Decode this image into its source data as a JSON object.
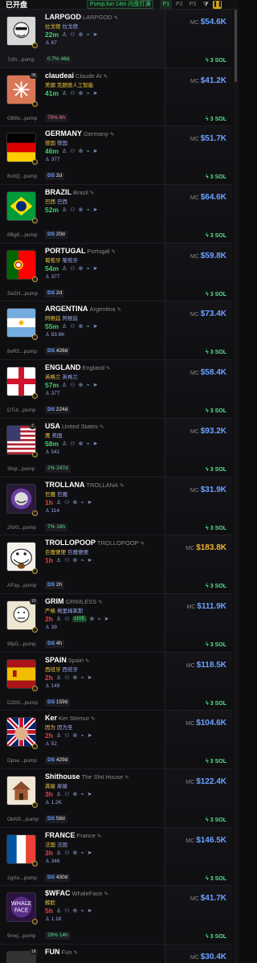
{
  "header": {
    "title": "已开盘",
    "filter": "Pump.fun 14m 内盘打满",
    "tabs": [
      "P1",
      "P2",
      "P3"
    ],
    "pause_icon": "pause-icon",
    "filter_icon": "funnel-icon"
  },
  "colors": {
    "green": "#3ad36b",
    "blue": "#6ea1ff",
    "yellow": "#f3b32c",
    "red": "#e44040"
  },
  "rows": [
    {
      "ticker": "LARPGOD",
      "fullname": "LARPGOD",
      "cn": "拉戈德",
      "cn2": "拉戈德",
      "age": "22m",
      "holders": "67",
      "addr": "7cfn...pump",
      "bottom1": "0.7% 46d",
      "mc_label": "MC",
      "mc": "$54.6K",
      "sol": "3 SOL",
      "avatar": "cartoon"
    },
    {
      "ticker": "claudeai",
      "fullname": "Claude AI",
      "cn": "美國 克朗德人工智能",
      "cn2": "",
      "age": "41m",
      "holders": "",
      "addr": "GB8v...pump",
      "bottom1": "79% 6h",
      "mc_label": "MC",
      "mc": "$41.2K",
      "sol": "3 SOL",
      "avatar": "claude",
      "badge": "38"
    },
    {
      "ticker": "GERMANY",
      "fullname": "Germany",
      "cn": "德国",
      "cn2": "德国",
      "age": "46m",
      "holders": "377",
      "addr": "8v3Q...pump",
      "bottom1": "DS 2d",
      "mc_label": "MC",
      "mc": "$51.7K",
      "sol": "3 SOL",
      "avatar": "germany"
    },
    {
      "ticker": "BRAZIL",
      "fullname": "Brazil",
      "cn": "巴西",
      "cn2": "巴西",
      "age": "52m",
      "holders": "",
      "addr": "8BgK...pump",
      "bottom1": "DS 20d",
      "mc_label": "MC",
      "mc": "$64.6K",
      "sol": "3 SOL",
      "avatar": "brazil"
    },
    {
      "ticker": "PORTUGAL",
      "fullname": "Portugal",
      "cn": "葡萄牙",
      "cn2": "葡萄牙",
      "age": "54m",
      "holders": "377",
      "addr": "Se2H...pump",
      "bottom1": "DS 2d",
      "mc_label": "MC",
      "mc": "$59.8K",
      "sol": "3 SOL",
      "avatar": "portugal"
    },
    {
      "ticker": "ARGENTINA",
      "fullname": "Argentina",
      "cn": "阿根廷",
      "cn2": "阿根廷",
      "age": "55m",
      "holders": "83.8K",
      "addr": "8vR5...pump",
      "bottom1": "DS 428d",
      "mc_label": "MC",
      "mc": "$73.4K",
      "sol": "3 SOL",
      "avatar": "argentina"
    },
    {
      "ticker": "ENGLAND",
      "fullname": "England",
      "cn": "英格兰",
      "cn2": "英格兰",
      "age": "57m",
      "holders": "377",
      "addr": "DTut...pump",
      "bottom1": "DS 224d",
      "mc_label": "MC",
      "mc": "$58.4K",
      "sol": "3 SOL",
      "avatar": "england"
    },
    {
      "ticker": "USA",
      "fullname": "United States",
      "cn": "鹰",
      "cn2": "美国",
      "age": "58m",
      "holders": "541",
      "addr": "3hqr...pump",
      "bottom1": "2% 247d",
      "mc_label": "MC",
      "mc": "$93.2K",
      "sol": "3 SOL",
      "avatar": "usa",
      "badge": "3"
    },
    {
      "ticker": "TROLLANA",
      "fullname": "TROLLANA",
      "cn": "巨魔",
      "cn2": "巨魔",
      "age": "1h",
      "holders": "114",
      "addr": "2NXt...pump",
      "bottom1": "7% 16h",
      "mc_label": "MC",
      "mc": "$31.9K",
      "sol": "3 SOL",
      "avatar": "trollana",
      "agered": true
    },
    {
      "ticker": "TROLLOPOOP",
      "fullname": "TROLLOPOOP",
      "cn": "巨魔便便",
      "cn2": "巨魔便便",
      "age": "1h",
      "holders": "",
      "addr": "AFay...pump",
      "bottom1": "DS 2h",
      "mc_label": "MC",
      "mc": "$183.8K",
      "sol": "3 SOL",
      "avatar": "trollface",
      "agered": true,
      "mcyellow": true
    },
    {
      "ticker": "GRIM",
      "fullname": "GRIMLESS",
      "cn": "严格",
      "cn2": "格里姆莱斯",
      "age": "2h",
      "holders": "39",
      "addr": "9fpG...pump",
      "bottom1": "DS 4h",
      "mc_label": "MC",
      "mc": "$111.9K",
      "sol": "3 SOL",
      "avatar": "grim",
      "agered": true,
      "live": "LIVE",
      "badge": "10"
    },
    {
      "ticker": "SPAIN",
      "fullname": "Spain",
      "cn": "西班牙",
      "cn2": "西班牙",
      "age": "2h",
      "holders": "149",
      "addr": "D2bS...pump",
      "bottom1": "DS 159d",
      "mc_label": "MC",
      "mc": "$118.5K",
      "sol": "3 SOL",
      "avatar": "spain",
      "agered": true
    },
    {
      "ticker": "Ker",
      "fullname": "Ker Stemur",
      "cn": "因为",
      "cn2": "因为圣",
      "age": "2h",
      "holders": "52",
      "addr": "Dpse...pump",
      "bottom1": "DS 429d",
      "mc_label": "MC",
      "mc": "$104.6K",
      "sol": "3 SOL",
      "avatar": "ker",
      "agered": true
    },
    {
      "ticker": "Shithouse",
      "fullname": "The Shit House",
      "cn": "粪屋",
      "cn2": "屎屋",
      "age": "3h",
      "holders": "1.2K",
      "addr": "GkNS...pump",
      "bottom1": "DS 58d",
      "mc_label": "MC",
      "mc": "$122.4K",
      "sol": "3 SOL",
      "avatar": "house",
      "agered": true
    },
    {
      "ticker": "FRANCE",
      "fullname": "France",
      "cn": "法国",
      "cn2": "法国",
      "age": "3h",
      "holders": "346",
      "addr": "2gXe...pump",
      "bottom1": "DS 430d",
      "mc_label": "MC",
      "mc": "$146.5K",
      "sol": "3 SOL",
      "avatar": "france",
      "agered": true
    },
    {
      "ticker": "$WFAC",
      "fullname": "WhaleFace",
      "cn": "鲸脸",
      "cn2": "",
      "age": "5h",
      "holders": "1.1K",
      "addr": "9vvq...pump",
      "bottom1": "29% 14h",
      "mc_label": "MC",
      "mc": "$41.7K",
      "sol": "3 SOL",
      "avatar": "whale",
      "agered": true
    },
    {
      "ticker": "FUN",
      "fullname": "Fun",
      "cn": "",
      "cn2": "",
      "age": "",
      "holders": "",
      "addr": "",
      "bottom1": "",
      "mc_label": "MC",
      "mc": "$30.4K",
      "sol": "",
      "avatar": "fun",
      "badge": "18"
    }
  ]
}
